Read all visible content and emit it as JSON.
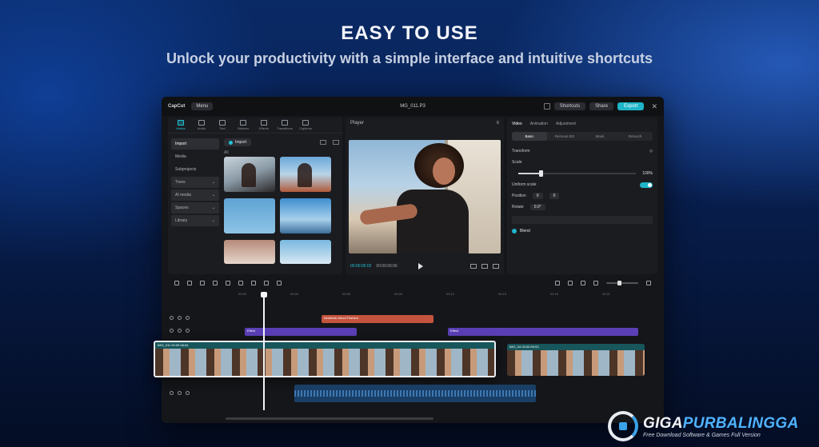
{
  "hero": {
    "headline": "EASY TO USE",
    "subline": "Unlock your productivity with a simple interface and intuitive shortcuts"
  },
  "app": {
    "logo": "CapCut",
    "menu_label": "Menu",
    "project_name": "MG_011.P3",
    "shortcuts_label": "Shortcuts",
    "share_label": "Share",
    "export_label": "Export"
  },
  "toolbar_tabs": [
    {
      "label": "Media"
    },
    {
      "label": "Audio"
    },
    {
      "label": "Text"
    },
    {
      "label": "Stickers"
    },
    {
      "label": "Effects"
    },
    {
      "label": "Transitions"
    },
    {
      "label": "Captions"
    }
  ],
  "side_nav": {
    "items": [
      "Import",
      "Media",
      "Subprojects"
    ],
    "dropdowns": [
      "Trees",
      "AI media",
      "Spaces",
      "Library"
    ]
  },
  "media": {
    "import_label": "Import",
    "section_label": "All"
  },
  "player": {
    "title": "Player",
    "time_current": "00:00:05:02",
    "time_total": "00:00:06:06"
  },
  "inspector": {
    "tabs": [
      "Video",
      "Animation",
      "Adjustment"
    ],
    "segments": [
      "Basic",
      "Remove BG",
      "Mask",
      "Retouch"
    ],
    "transform_label": "Transform",
    "scale_label": "Scale",
    "scale_value": "100%",
    "uniform_label": "Uniform scale",
    "position_label": "Position",
    "pos_x": "0",
    "pos_y": "0",
    "rotate_label": "Rotate",
    "rotate_value": "0.0°",
    "blend_label": "Blend"
  },
  "timeline": {
    "ruler": [
      "00:00",
      "00:03",
      "00:06",
      "00:09",
      "00:12",
      "00:15",
      "00:18",
      "00:21"
    ],
    "text_clip": "Aesthetic Mood Fashion",
    "fx_clip_1": "Effect",
    "fx_clip_2": "Effect",
    "main_clip": "IMG_011 00:00:08:04",
    "clip2": "IMG_04 00:00:09:03"
  },
  "watermark": {
    "title_a": "GIGA",
    "title_b": "PURBALINGGA",
    "sub": "Free Download Software & Games Full Version"
  }
}
